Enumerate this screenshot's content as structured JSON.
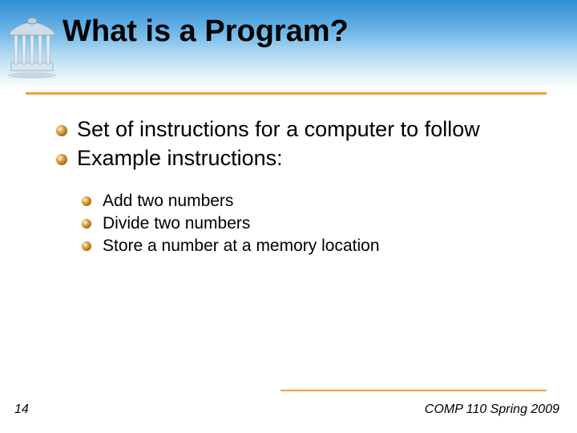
{
  "title": "What is a Program?",
  "bullets": {
    "level1": [
      "Set of instructions for a computer to follow",
      "Example instructions:"
    ],
    "level2": [
      "Add two numbers",
      "Divide two numbers",
      "Store a number at a memory location"
    ]
  },
  "footer": {
    "page": "14",
    "course": "COMP 110 Spring 2009"
  },
  "logo_alt": "UNC Old Well"
}
